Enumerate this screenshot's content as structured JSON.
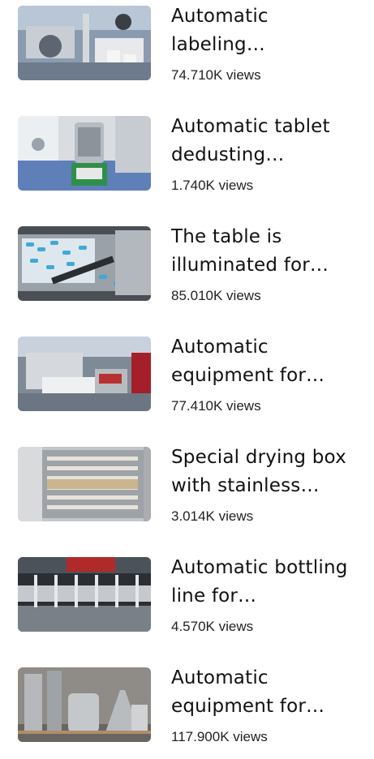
{
  "videos": [
    {
      "title": "Automatic labeling…",
      "views": "74.710K views"
    },
    {
      "title": "Automatic tablet dedusting…",
      "views": "1.740K views"
    },
    {
      "title": "The table is illuminated for…",
      "views": "85.010K views"
    },
    {
      "title": "Automatic equipment for…",
      "views": "77.410K views"
    },
    {
      "title": "Special drying box with stainless…",
      "views": "3.014K views"
    },
    {
      "title": "Automatic bottling line for…",
      "views": "4.570K views"
    },
    {
      "title": "Automatic equipment for…",
      "views": "117.900K views"
    }
  ]
}
